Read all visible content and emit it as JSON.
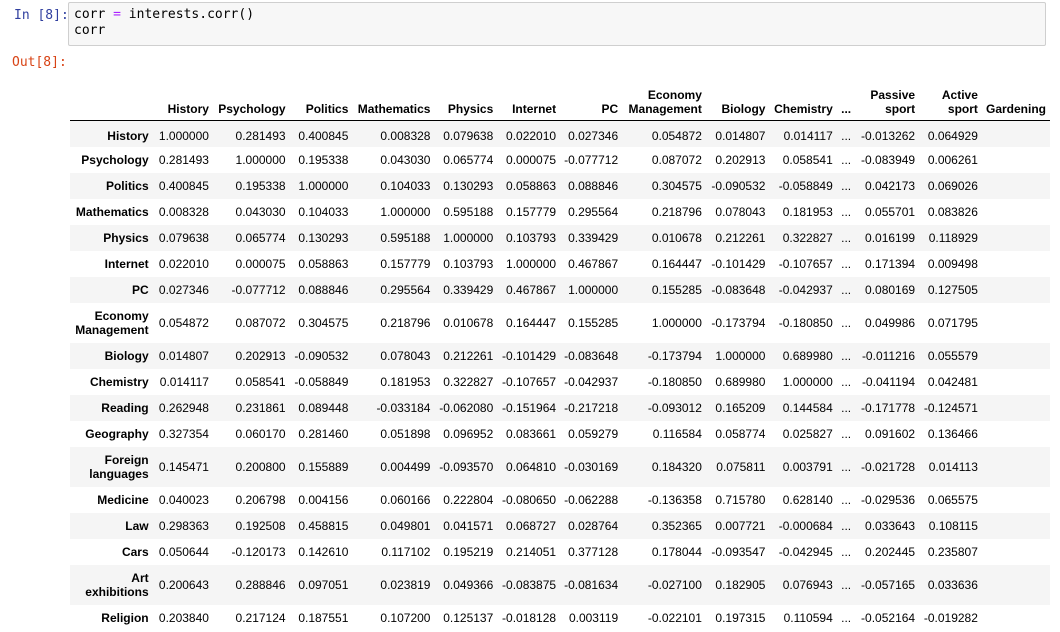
{
  "cells": {
    "in_prompt": "In [8]:",
    "out_prompt": "Out[8]:",
    "code_line1_var": "corr",
    "code_line1_op": "=",
    "code_line1_rest": "interests.corr()",
    "code_line2": "corr"
  },
  "table": {
    "columns": [
      "History",
      "Psychology",
      "Politics",
      "Mathematics",
      "Physics",
      "Internet",
      "PC",
      "Economy\nManagement",
      "Biology",
      "Chemistry",
      "...",
      "Passive\nsport",
      "Active\nsport",
      "Gardening"
    ],
    "rows": [
      {
        "label": "History",
        "values": [
          "1.000000",
          "0.281493",
          "0.400845",
          "0.008328",
          "0.079638",
          "0.022010",
          "0.027346",
          "0.054872",
          "0.014807",
          "0.014117",
          "...",
          "-0.013262",
          "0.064929",
          ""
        ]
      },
      {
        "label": "Psychology",
        "values": [
          "0.281493",
          "1.000000",
          "0.195338",
          "0.043030",
          "0.065774",
          "0.000075",
          "-0.077712",
          "0.087072",
          "0.202913",
          "0.058541",
          "...",
          "-0.083949",
          "0.006261",
          ""
        ]
      },
      {
        "label": "Politics",
        "values": [
          "0.400845",
          "0.195338",
          "1.000000",
          "0.104033",
          "0.130293",
          "0.058863",
          "0.088846",
          "0.304575",
          "-0.090532",
          "-0.058849",
          "...",
          "0.042173",
          "0.069026",
          ""
        ]
      },
      {
        "label": "Mathematics",
        "values": [
          "0.008328",
          "0.043030",
          "0.104033",
          "1.000000",
          "0.595188",
          "0.157779",
          "0.295564",
          "0.218796",
          "0.078043",
          "0.181953",
          "...",
          "0.055701",
          "0.083826",
          ""
        ]
      },
      {
        "label": "Physics",
        "values": [
          "0.079638",
          "0.065774",
          "0.130293",
          "0.595188",
          "1.000000",
          "0.103793",
          "0.339429",
          "0.010678",
          "0.212261",
          "0.322827",
          "...",
          "0.016199",
          "0.118929",
          ""
        ]
      },
      {
        "label": "Internet",
        "values": [
          "0.022010",
          "0.000075",
          "0.058863",
          "0.157779",
          "0.103793",
          "1.000000",
          "0.467867",
          "0.164447",
          "-0.101429",
          "-0.107657",
          "...",
          "0.171394",
          "0.009498",
          ""
        ]
      },
      {
        "label": "PC",
        "values": [
          "0.027346",
          "-0.077712",
          "0.088846",
          "0.295564",
          "0.339429",
          "0.467867",
          "1.000000",
          "0.155285",
          "-0.083648",
          "-0.042937",
          "...",
          "0.080169",
          "0.127505",
          ""
        ]
      },
      {
        "label": "Economy\nManagement",
        "values": [
          "0.054872",
          "0.087072",
          "0.304575",
          "0.218796",
          "0.010678",
          "0.164447",
          "0.155285",
          "1.000000",
          "-0.173794",
          "-0.180850",
          "...",
          "0.049986",
          "0.071795",
          ""
        ]
      },
      {
        "label": "Biology",
        "values": [
          "0.014807",
          "0.202913",
          "-0.090532",
          "0.078043",
          "0.212261",
          "-0.101429",
          "-0.083648",
          "-0.173794",
          "1.000000",
          "0.689980",
          "...",
          "-0.011216",
          "0.055579",
          ""
        ]
      },
      {
        "label": "Chemistry",
        "values": [
          "0.014117",
          "0.058541",
          "-0.058849",
          "0.181953",
          "0.322827",
          "-0.107657",
          "-0.042937",
          "-0.180850",
          "0.689980",
          "1.000000",
          "...",
          "-0.041194",
          "0.042481",
          ""
        ]
      },
      {
        "label": "Reading",
        "values": [
          "0.262948",
          "0.231861",
          "0.089448",
          "-0.033184",
          "-0.062080",
          "-0.151964",
          "-0.217218",
          "-0.093012",
          "0.165209",
          "0.144584",
          "...",
          "-0.171778",
          "-0.124571",
          ""
        ]
      },
      {
        "label": "Geography",
        "values": [
          "0.327354",
          "0.060170",
          "0.281460",
          "0.051898",
          "0.096952",
          "0.083661",
          "0.059279",
          "0.116584",
          "0.058774",
          "0.025827",
          "...",
          "0.091602",
          "0.136466",
          ""
        ]
      },
      {
        "label": "Foreign\nlanguages",
        "values": [
          "0.145471",
          "0.200800",
          "0.155889",
          "0.004499",
          "-0.093570",
          "0.064810",
          "-0.030169",
          "0.184320",
          "0.075811",
          "0.003791",
          "...",
          "-0.021728",
          "0.014113",
          ""
        ]
      },
      {
        "label": "Medicine",
        "values": [
          "0.040023",
          "0.206798",
          "0.004156",
          "0.060166",
          "0.222804",
          "-0.080650",
          "-0.062288",
          "-0.136358",
          "0.715780",
          "0.628140",
          "...",
          "-0.029536",
          "0.065575",
          ""
        ]
      },
      {
        "label": "Law",
        "values": [
          "0.298363",
          "0.192508",
          "0.458815",
          "0.049801",
          "0.041571",
          "0.068727",
          "0.028764",
          "0.352365",
          "0.007721",
          "-0.000684",
          "...",
          "0.033643",
          "0.108115",
          ""
        ]
      },
      {
        "label": "Cars",
        "values": [
          "0.050644",
          "-0.120173",
          "0.142610",
          "0.117102",
          "0.195219",
          "0.214051",
          "0.377128",
          "0.178044",
          "-0.093547",
          "-0.042945",
          "...",
          "0.202445",
          "0.235807",
          ""
        ]
      },
      {
        "label": "Art\nexhibitions",
        "values": [
          "0.200643",
          "0.288846",
          "0.097051",
          "0.023819",
          "0.049366",
          "-0.083875",
          "-0.081634",
          "-0.027100",
          "0.182905",
          "0.076943",
          "...",
          "-0.057165",
          "0.033636",
          ""
        ]
      },
      {
        "label": "Religion",
        "values": [
          "0.203840",
          "0.217124",
          "0.187551",
          "0.107200",
          "0.125137",
          "-0.018128",
          "0.003119",
          "-0.022101",
          "0.197315",
          "0.110594",
          "...",
          "-0.052164",
          "-0.019282",
          ""
        ]
      }
    ]
  }
}
